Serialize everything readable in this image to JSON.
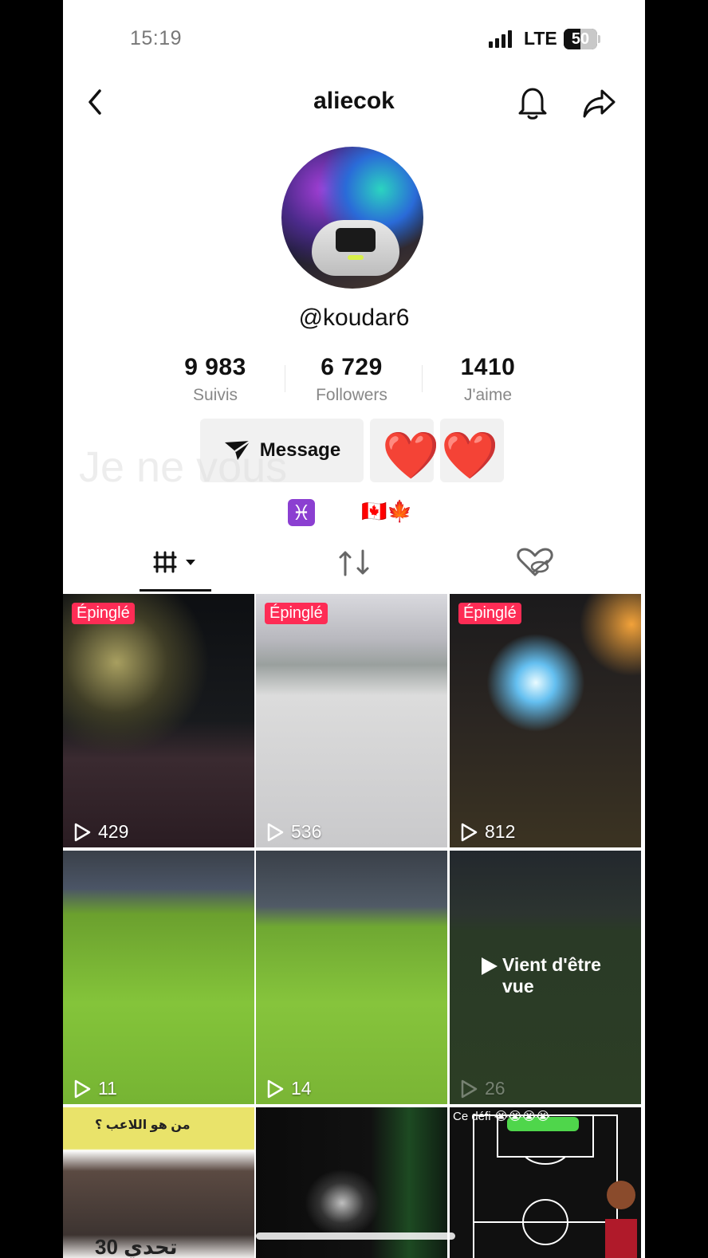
{
  "status_bar": {
    "time": "15:19",
    "network": "LTE",
    "battery": "50",
    "battery_level": 0.5
  },
  "header": {
    "title": "aliecok",
    "back_icon": "chevron-left-icon",
    "bell_icon": "bell-icon",
    "share_icon": "share-arrow-icon"
  },
  "profile": {
    "handle": "@koudar6",
    "stats": [
      {
        "value": "9 983",
        "label": "Suivis"
      },
      {
        "value": "6 729",
        "label": "Followers"
      },
      {
        "value": "1410",
        "label": "J'aime"
      }
    ],
    "message_label": "Message",
    "overlay_text": "Je ne vous",
    "emoji_overlay": "❤️❤️",
    "bio": {
      "zodiac": "♓",
      "flags": "🇨🇦🍁"
    }
  },
  "tabs": [
    {
      "name": "videos",
      "icon": "grid-icon",
      "selected": true
    },
    {
      "name": "reposts",
      "icon": "repost-icon",
      "selected": false
    },
    {
      "name": "liked",
      "icon": "heart-hidden-icon",
      "selected": false
    }
  ],
  "videos": [
    {
      "pinned": "Épinglé",
      "views": "429"
    },
    {
      "pinned": "Épinglé",
      "views": "536"
    },
    {
      "pinned": "Épinglé",
      "views": "812"
    },
    {
      "views": "11"
    },
    {
      "views": "14"
    },
    {
      "views": "26",
      "just_seen": "Vient d'être vue"
    },
    {
      "caption_ar_top": "من هو اللاعب ؟",
      "caption_ar_bottom": "تحدي 30"
    },
    {},
    {
      "caption": "Ce défi 😭😭😭😭"
    }
  ],
  "colors": {
    "pin": "#fe2c55",
    "zodiac_bg": "#8b3fd1"
  }
}
